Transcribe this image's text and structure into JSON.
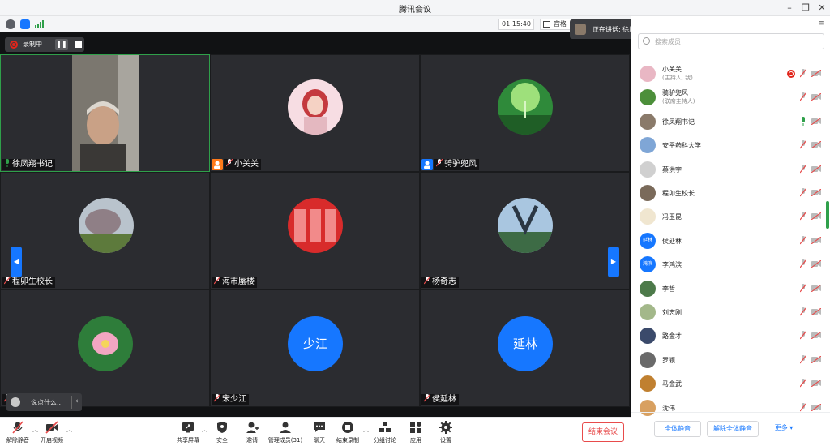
{
  "window": {
    "title": "腾讯会议"
  },
  "toolbar_top": {
    "timer": "01:15:40",
    "layout_label": "宫格视图"
  },
  "recording": {
    "label": "录制中"
  },
  "speaking_banner": {
    "text": "正在讲话: 徐凤翔书记;"
  },
  "video_tiles": [
    {
      "name": "徐凤翔书记",
      "mic": "on",
      "kind": "camera"
    },
    {
      "name": "小关关",
      "mic": "off",
      "kind": "avatar",
      "badge": "host"
    },
    {
      "name": "骑驴兜风",
      "mic": "off",
      "kind": "avatar",
      "badge": "cohost"
    },
    {
      "name": "程卯生校长",
      "mic": "off",
      "kind": "avatar"
    },
    {
      "name": "海市蜃楼",
      "mic": "off",
      "kind": "avatar"
    },
    {
      "name": "杨奇志",
      "mic": "off",
      "kind": "avatar"
    },
    {
      "name": "李哲",
      "mic": "off",
      "kind": "avatar"
    },
    {
      "name": "宋少江",
      "mic": "off",
      "kind": "text",
      "avatar_text": "少江"
    },
    {
      "name": "侯延林",
      "mic": "off",
      "kind": "text",
      "avatar_text": "延林"
    }
  ],
  "chat": {
    "placeholder": "说点什么..."
  },
  "bottom_toolbar": {
    "unmute": "解除静音",
    "start_video": "开启视频",
    "share_screen": "共享屏幕",
    "security": "安全",
    "invite": "邀请",
    "manage_members": "管理成员(31)",
    "chat": "聊天",
    "end_recording": "结束录制",
    "breakout": "分组讨论",
    "apps": "应用",
    "settings": "设置",
    "end_meeting": "结束会议"
  },
  "panel": {
    "search_placeholder": "搜索成员",
    "members": [
      {
        "name": "小关关",
        "role": "(主持人, 我)",
        "mic": "off",
        "recording": true
      },
      {
        "name": "骑驴兜风",
        "role": "(联席主持人)",
        "mic": "off"
      },
      {
        "name": "徐凤翔书记",
        "role": "",
        "mic": "on"
      },
      {
        "name": "安平药科大学",
        "role": "",
        "mic": "off"
      },
      {
        "name": "蔡洪宇",
        "role": "",
        "mic": "off"
      },
      {
        "name": "程卯生校长",
        "role": "",
        "mic": "off"
      },
      {
        "name": "冯玉昆",
        "role": "",
        "mic": "off"
      },
      {
        "name": "侯延林",
        "role": "",
        "mic": "off",
        "avatar_text": "延林"
      },
      {
        "name": "李鸿滨",
        "role": "",
        "mic": "off",
        "avatar_text": "鸿滨"
      },
      {
        "name": "李哲",
        "role": "",
        "mic": "off"
      },
      {
        "name": "刘志刚",
        "role": "",
        "mic": "off"
      },
      {
        "name": "路金才",
        "role": "",
        "mic": "off"
      },
      {
        "name": "罗颖",
        "role": "",
        "mic": "off"
      },
      {
        "name": "马金武",
        "role": "",
        "mic": "off"
      },
      {
        "name": "沈伟",
        "role": "",
        "mic": "off"
      }
    ],
    "mute_all": "全体静音",
    "unmute_all": "解除全体静音",
    "more": "更多"
  },
  "colors": {
    "accent": "#1677ff",
    "danger": "#e84b4b",
    "speaking": "#2fa04a",
    "stage_bg": "#111214",
    "tile_bg": "#2b2c30"
  }
}
